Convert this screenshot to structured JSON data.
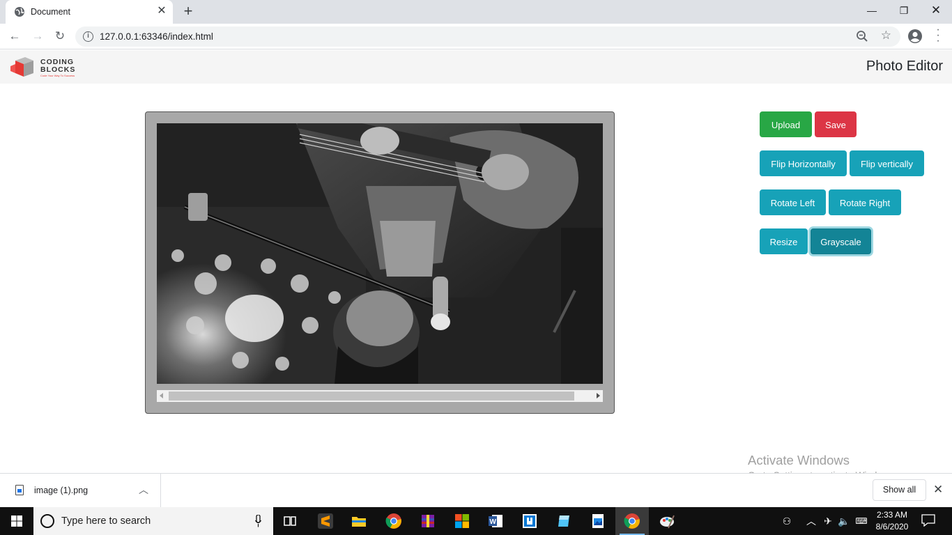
{
  "browser": {
    "tab_title": "Document",
    "url": "127.0.0.1:63346/index.html"
  },
  "app": {
    "logo_word1": "CODING",
    "logo_word2": "BLOCKS",
    "logo_tagline": "Code Your Way To Success",
    "title": "Photo Editor"
  },
  "buttons": {
    "upload": "Upload",
    "save": "Save",
    "flip_h": "Flip Horizontally",
    "flip_v": "Flip vertically",
    "rotate_left": "Rotate Left",
    "rotate_right": "Rotate Right",
    "resize": "Resize",
    "grayscale": "Grayscale"
  },
  "watermark": {
    "line1": "Activate Windows",
    "line2": "Go to Settings to activate Windows."
  },
  "downloads": {
    "file_name": "image (1).png",
    "show_all": "Show all"
  },
  "taskbar": {
    "search_placeholder": "Type here to search",
    "time": "2:33 AM",
    "date": "8/6/2020"
  },
  "colors": {
    "success": "#28a745",
    "danger": "#dc3545",
    "info": "#17a2b8",
    "navbar_bg": "#f5f5f5"
  }
}
